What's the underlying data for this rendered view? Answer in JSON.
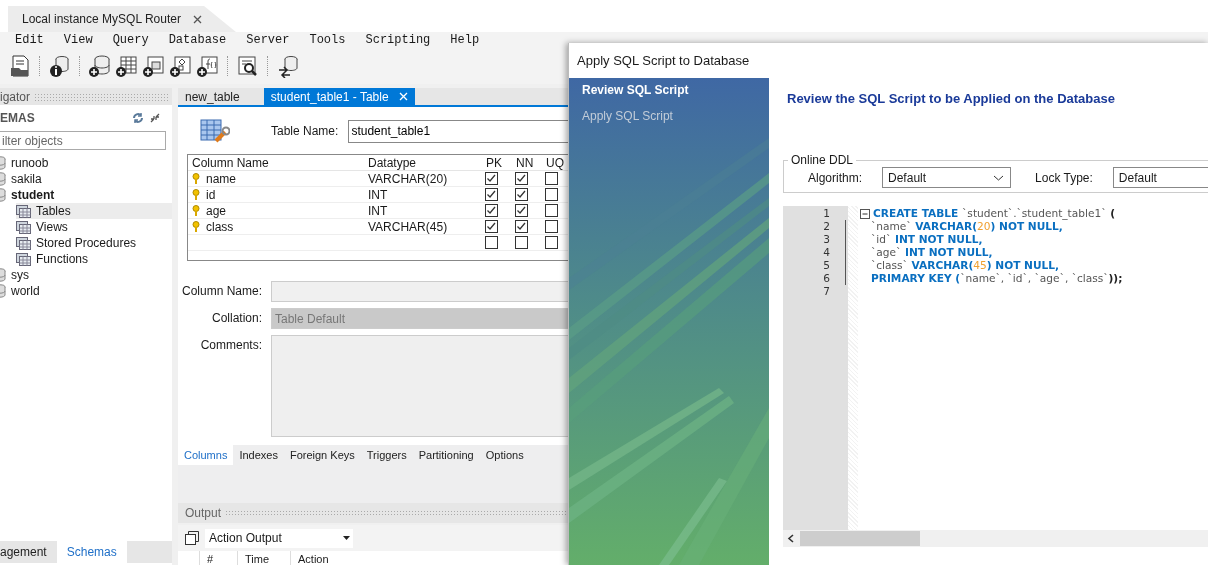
{
  "app_tabs": [
    {
      "label": "Local instance MySQL Router",
      "selected": true
    }
  ],
  "menu": [
    "Edit",
    "View",
    "Query",
    "Database",
    "Server",
    "Tools",
    "Scripting",
    "Help"
  ],
  "navigator": {
    "title": "igator",
    "section": "EMAS",
    "filter": {
      "placeholder": "ilter objects"
    },
    "schemas": [
      {
        "label": "runoob",
        "active": false,
        "selected": false
      },
      {
        "label": "sakila",
        "active": false,
        "selected": false
      },
      {
        "label": "student",
        "active": true,
        "selected": false,
        "children": [
          {
            "label": "Tables",
            "selected": true
          },
          {
            "label": "Views",
            "selected": false
          },
          {
            "label": "Stored Procedures",
            "selected": false
          },
          {
            "label": "Functions",
            "selected": false
          }
        ]
      },
      {
        "label": "sys",
        "active": false,
        "selected": false
      },
      {
        "label": "world",
        "active": false,
        "selected": false
      }
    ],
    "bottom_tabs": [
      {
        "label": "agement",
        "selected": false
      },
      {
        "label": "Schemas",
        "selected": true
      }
    ]
  },
  "editor_tabs": [
    {
      "label": "new_table",
      "selected": false,
      "closable": false
    },
    {
      "label": "student_table1 - Table",
      "selected": true,
      "closable": true
    }
  ],
  "table_editor": {
    "table_name_label": "Table Name:",
    "table_name": "student_table1",
    "grid": {
      "columns": [
        "Column Name",
        "Datatype",
        "PK",
        "NN",
        "UQ"
      ],
      "rows": [
        {
          "name": "name",
          "datatype": "VARCHAR(20)",
          "pk": true,
          "nn": true,
          "uq": false
        },
        {
          "name": "id",
          "datatype": "INT",
          "pk": true,
          "nn": true,
          "uq": false
        },
        {
          "name": "age",
          "datatype": "INT",
          "pk": true,
          "nn": true,
          "uq": false
        },
        {
          "name": "class",
          "datatype": "VARCHAR(45)",
          "pk": true,
          "nn": true,
          "uq": false
        },
        {
          "pk": false,
          "nn": false,
          "uq": false
        }
      ]
    },
    "details": [
      {
        "label": "Column Name:",
        "kind": "text",
        "disabled": true
      },
      {
        "label": "Collation:",
        "kind": "select",
        "value": "Table Default",
        "disabled": true
      },
      {
        "label": "Comments:",
        "kind": "textarea",
        "disabled": true
      }
    ],
    "tabs": [
      {
        "label": "Columns",
        "selected": true
      },
      {
        "label": "Indexes",
        "selected": false
      },
      {
        "label": "Foreign Keys",
        "selected": false
      },
      {
        "label": "Triggers",
        "selected": false
      },
      {
        "label": "Partitioning",
        "selected": false
      },
      {
        "label": "Options",
        "selected": false
      }
    ]
  },
  "output": {
    "title": "Output",
    "selector": "Action Output",
    "columns": [
      "#",
      "Time",
      "Action"
    ]
  },
  "dialog": {
    "title": "Apply SQL Script to Database",
    "steps": [
      {
        "label": "Review SQL Script",
        "selected": true
      },
      {
        "label": "Apply SQL Script",
        "selected": false
      }
    ],
    "heading": "Review the SQL Script to be Applied on the Database",
    "online_ddl": {
      "title": "Online DDL",
      "algorithm": {
        "label": "Algorithm:",
        "value": "Default"
      },
      "lock_type": {
        "label": "Lock Type:",
        "value": "Default"
      }
    },
    "script": [
      {
        "number": "1",
        "tokens": [
          {
            "text": "CREATE TABLE ",
            "kind": "keyword"
          },
          {
            "text": "`student`.`student_table1`",
            "kind": "identifier"
          },
          {
            "text": " (",
            "kind": "punctuation"
          }
        ],
        "children": [
          {
            "number": "2",
            "tokens": [
              {
                "text": "`name`",
                "kind": "identifier"
              },
              {
                "text": " VARCHAR(",
                "kind": "keyword"
              },
              {
                "text": "20",
                "kind": "number"
              },
              {
                "text": ") NOT NULL,",
                "kind": "keyword"
              }
            ]
          },
          {
            "number": "3",
            "tokens": [
              {
                "text": "`id`",
                "kind": "identifier"
              },
              {
                "text": " INT NOT NULL,",
                "kind": "keyword"
              }
            ]
          },
          {
            "number": "4",
            "tokens": [
              {
                "text": "`age`",
                "kind": "identifier"
              },
              {
                "text": " INT NOT NULL,",
                "kind": "keyword"
              }
            ]
          },
          {
            "number": "5",
            "tokens": [
              {
                "text": "`class`",
                "kind": "identifier"
              },
              {
                "text": " VARCHAR(",
                "kind": "keyword"
              },
              {
                "text": "45",
                "kind": "number"
              },
              {
                "text": ") NOT NULL,",
                "kind": "keyword"
              }
            ]
          },
          {
            "number": "6",
            "tokens": [
              {
                "text": "PRIMARY KEY (",
                "kind": "keyword"
              },
              {
                "text": "`name`, `id`, `age`, `class`",
                "kind": "identifier"
              },
              {
                "text": "));",
                "kind": "punctuation"
              }
            ]
          }
        ]
      },
      {
        "number": "7"
      }
    ]
  }
}
